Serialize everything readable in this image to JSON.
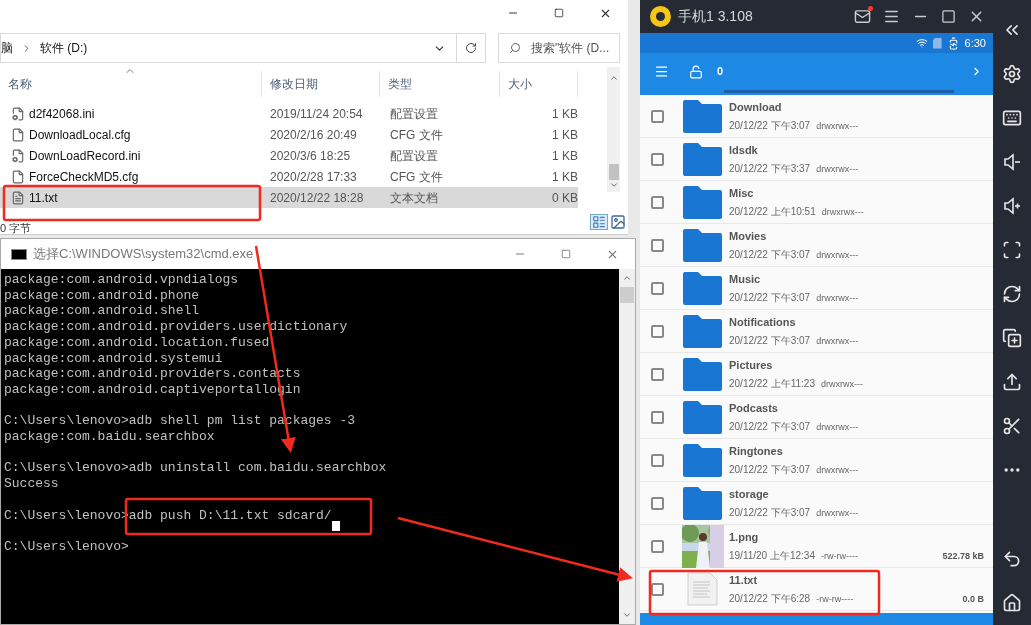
{
  "explorer": {
    "address": [
      "脑",
      "软件 (D:)"
    ],
    "search_placeholder": "搜索\"软件 (D...",
    "columns": [
      "名称",
      "修改日期",
      "类型",
      "大小"
    ],
    "rows": [
      {
        "name": "d2f42068.ini",
        "date": "2019/11/24 20:54",
        "type": "配置设置",
        "size": "1 KB",
        "kind": "settings",
        "selected": false
      },
      {
        "name": "DownloadLocal.cfg",
        "date": "2020/2/16 20:49",
        "type": "CFG 文件",
        "size": "1 KB",
        "kind": "file",
        "selected": false
      },
      {
        "name": "DownLoadRecord.ini",
        "date": "2020/3/6 18:25",
        "type": "配置设置",
        "size": "1 KB",
        "kind": "settings",
        "selected": false
      },
      {
        "name": "ForceCheckMD5.cfg",
        "date": "2020/2/28 17:33",
        "type": "CFG 文件",
        "size": "1 KB",
        "kind": "file",
        "selected": false
      },
      {
        "name": "11.txt",
        "date": "2020/12/22 18:28",
        "type": "文本文档",
        "size": "0 KB",
        "kind": "text",
        "selected": true
      }
    ],
    "status": "0 字节"
  },
  "cmd": {
    "title": "选择C:\\WINDOWS\\system32\\cmd.exe",
    "groups": [
      {
        "lines": [
          "package:com.android.vpndialogs",
          "package:com.android.phone",
          "package:com.android.shell",
          "package:com.android.providers.userdictionary",
          "package:com.android.location.fused",
          "package:com.android.systemui",
          "package:com.android.providers.contacts",
          "package:com.android.captiveportallogin"
        ],
        "cursor": false
      },
      {
        "lines": [
          "C:\\Users\\lenovo>adb shell pm list packages -3",
          "package:com.baidu.searchbox"
        ],
        "cursor": false
      },
      {
        "lines": [
          "C:\\Users\\lenovo>adb uninstall com.baidu.searchbox",
          "Success"
        ],
        "cursor": false
      },
      {
        "lines": [
          "C:\\Users\\lenovo>adb push D:\\11.txt sdcard/"
        ],
        "cursor": true
      },
      {
        "lines": [
          "C:\\Users\\lenovo>"
        ],
        "cursor": false
      }
    ]
  },
  "emulator": {
    "title": "手机1 3.108",
    "mail_unread": true,
    "time": "6:30",
    "path": "0",
    "files": [
      {
        "name": "Download",
        "date": "20/12/22 下午3:07",
        "perms": "drwxrwx---",
        "kind": "folder",
        "checked": false
      },
      {
        "name": "ldsdk",
        "date": "20/12/22 下午3:37",
        "perms": "drwxrwx---",
        "kind": "folder",
        "checked": false
      },
      {
        "name": "Misc",
        "date": "20/12/22 上午10:51",
        "perms": "drwxrwx---",
        "kind": "folder",
        "checked": false
      },
      {
        "name": "Movies",
        "date": "20/12/22 下午3:07",
        "perms": "drwxrwx---",
        "kind": "folder",
        "checked": false
      },
      {
        "name": "Music",
        "date": "20/12/22 下午3:07",
        "perms": "drwxrwx---",
        "kind": "folder",
        "checked": false
      },
      {
        "name": "Notifications",
        "date": "20/12/22 下午3:07",
        "perms": "drwxrwx---",
        "kind": "folder",
        "checked": false
      },
      {
        "name": "Pictures",
        "date": "20/12/22 上午11:23",
        "perms": "drwxrwx---",
        "kind": "folder",
        "checked": false
      },
      {
        "name": "Podcasts",
        "date": "20/12/22 下午3:07",
        "perms": "drwxrwx---",
        "kind": "folder",
        "checked": false
      },
      {
        "name": "Ringtones",
        "date": "20/12/22 下午3:07",
        "perms": "drwxrwx---",
        "kind": "folder",
        "checked": false
      },
      {
        "name": "storage",
        "date": "20/12/22 下午3:07",
        "perms": "drwxrwx---",
        "kind": "folder",
        "checked": false
      },
      {
        "name": "1.png",
        "date": "19/11/20 上午12:34",
        "perms": "-rw-rw----",
        "size": "522.78 kB",
        "checked": false
      },
      {
        "name": "11.txt",
        "date": "20/12/22 下午6:28",
        "perms": "-rw-rw----",
        "size": "0.0 B",
        "kind": "text",
        "checked": false
      }
    ]
  }
}
